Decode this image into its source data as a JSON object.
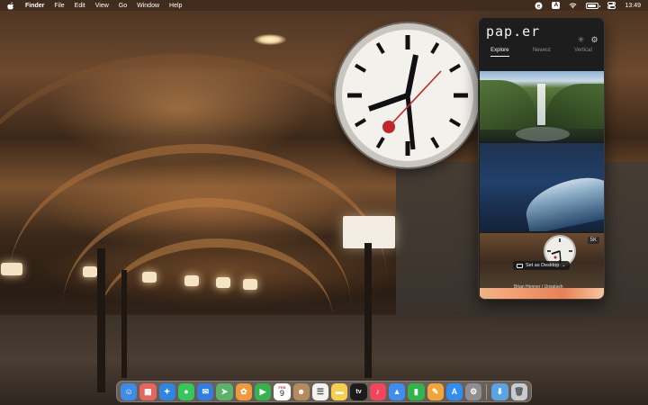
{
  "menubar": {
    "apple_icon": "apple-logo-icon",
    "app_name": "Finder",
    "menus": [
      "File",
      "Edit",
      "View",
      "Go",
      "Window",
      "Help"
    ],
    "status_input_source": "A",
    "clock": "13:49",
    "battery_level_fraction": 0.85
  },
  "paper": {
    "logo": "pap.er",
    "tabs": [
      {
        "label": "Explore",
        "active": true
      },
      {
        "label": "Newest",
        "active": false
      },
      {
        "label": "Vertical",
        "active": false
      }
    ],
    "hovered_wallpaper": {
      "resolution_badge": "5K",
      "set_button": "Set as Desktop",
      "credit": "Brian Henner / Unsplash"
    }
  },
  "dock": {
    "apps": [
      {
        "name": "finder",
        "glyph": "☺",
        "color": "#3f8be6"
      },
      {
        "name": "launchpad",
        "glyph": "▦",
        "color": "#e7655d"
      },
      {
        "name": "safari",
        "glyph": "✦",
        "color": "#2f86e0"
      },
      {
        "name": "messages",
        "glyph": "●",
        "color": "#34c759"
      },
      {
        "name": "mail",
        "glyph": "✉",
        "color": "#2f7ee0"
      },
      {
        "name": "maps",
        "glyph": "➤",
        "color": "#5bb36a"
      },
      {
        "name": "photos",
        "glyph": "✿",
        "color": "#f09a3e"
      },
      {
        "name": "facetime",
        "glyph": "▶",
        "color": "#34b34f"
      },
      {
        "name": "calendar",
        "month": "FEB",
        "day": "9"
      },
      {
        "name": "contacts",
        "glyph": "☻",
        "color": "#b38b5e"
      },
      {
        "name": "reminders",
        "glyph": "☰",
        "color": "#f2f2f2"
      },
      {
        "name": "notes",
        "glyph": "▬",
        "color": "#f6d04d"
      },
      {
        "name": "tv",
        "glyph": "tv",
        "color": "#1c1c1c"
      },
      {
        "name": "music",
        "glyph": "♪",
        "color": "#f0465b"
      },
      {
        "name": "keynote",
        "glyph": "▲",
        "color": "#3d8ef0"
      },
      {
        "name": "numbers",
        "glyph": "▮",
        "color": "#2fb54a"
      },
      {
        "name": "pages",
        "glyph": "✎",
        "color": "#f2a43a"
      },
      {
        "name": "app-store",
        "glyph": "A",
        "color": "#2f8ef2"
      },
      {
        "name": "system-settings",
        "glyph": "⚙",
        "color": "#8e8e93"
      },
      {
        "name": "downloads",
        "glyph": "⬇",
        "color": "#5aa4e6"
      },
      {
        "name": "trash",
        "glyph": "🗑",
        "color": "#c8ccd2"
      }
    ]
  }
}
